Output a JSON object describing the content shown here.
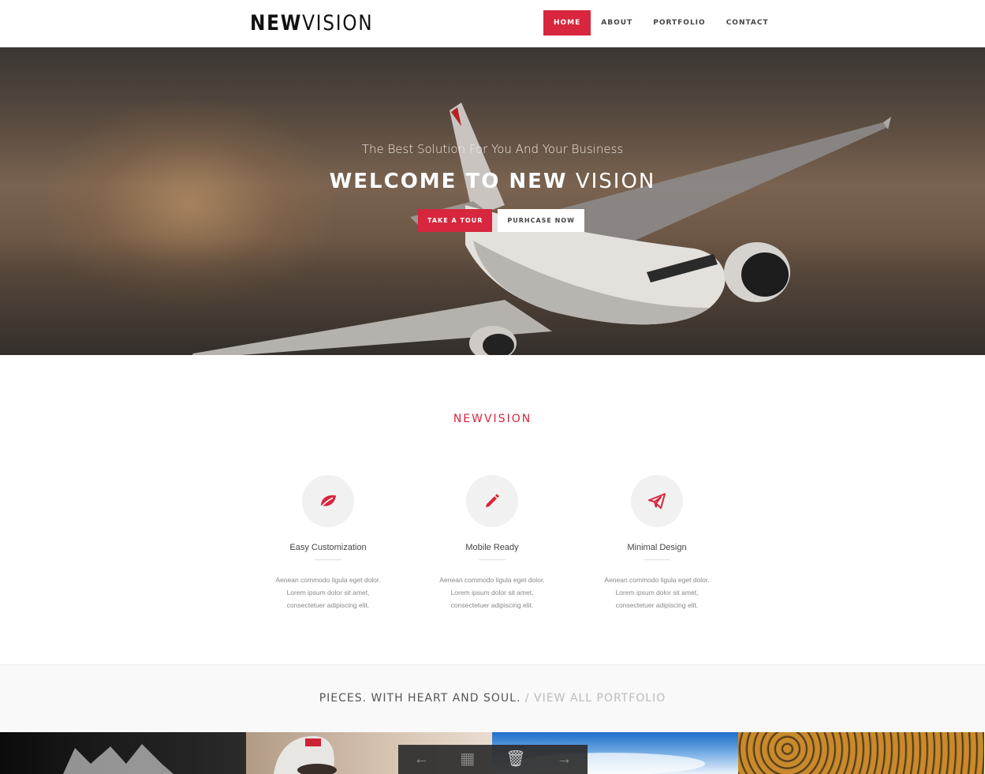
{
  "header": {
    "logo_bold": "NEW",
    "logo_light": "VISION",
    "nav": [
      "HOME",
      "ABOUT",
      "PORTFOLIO",
      "CONTACT"
    ]
  },
  "hero": {
    "subtitle": "The Best Solution For You And Your Business",
    "title_bold": "WELCOME TO NEW",
    "title_light": "VISION",
    "button_primary": "TAKE A TOUR",
    "button_secondary": "PURHCASE NOW"
  },
  "features": {
    "section_title": "NEWVISION",
    "items": [
      {
        "icon": "leaf-icon",
        "title": "Easy Customization",
        "text": "Aenean commodo ligula eget dolor. Lorem ipsum dolor sit amet, consectetuer adipiscing elit."
      },
      {
        "icon": "pencil-icon",
        "title": "Mobile Ready",
        "text": "Aenean commodo ligula eget dolor. Lorem ipsum dolor sit amet, consectetuer adipiscing elit."
      },
      {
        "icon": "paper-plane-icon",
        "title": "Minimal Design",
        "text": "Aenean commodo ligula eget dolor. Lorem ipsum dolor sit amet, consectetuer adipiscing elit."
      }
    ]
  },
  "portfolio": {
    "heading": "PIECES. WITH HEART AND SOUL.",
    "link": "/ VIEW ALL PORTFOLIO"
  },
  "colors": {
    "accent": "#d7263d"
  }
}
